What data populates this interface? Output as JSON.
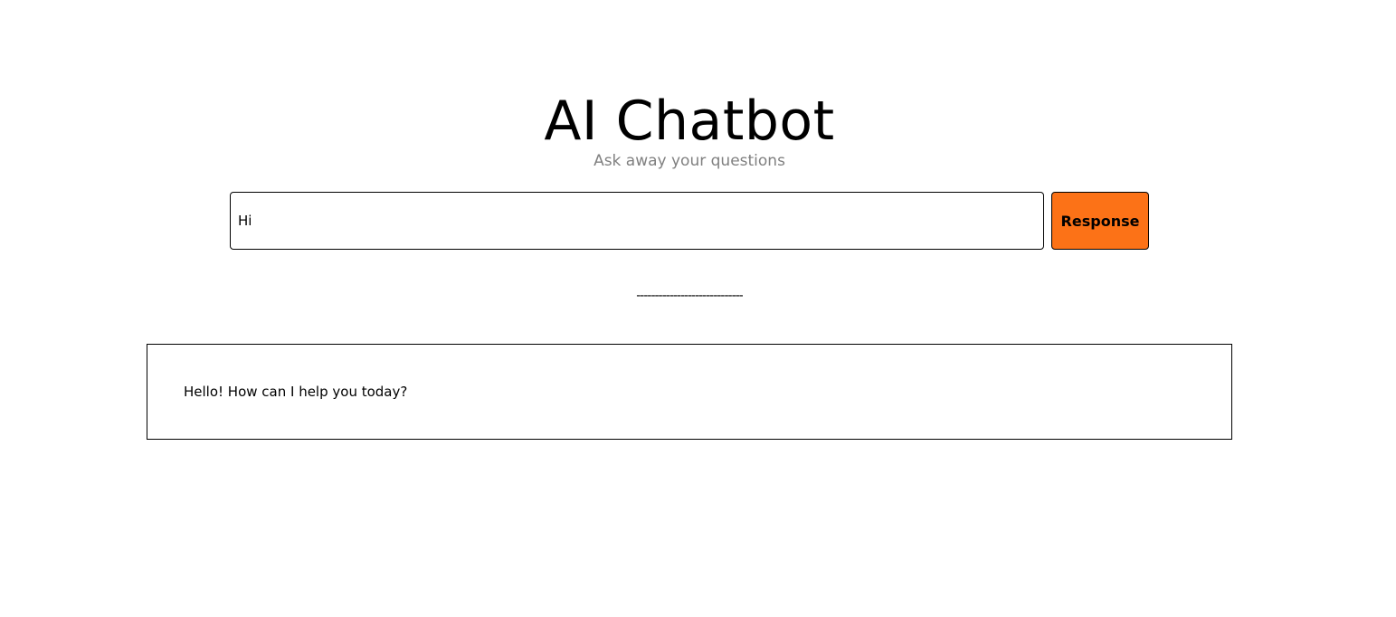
{
  "header": {
    "title": "AI Chatbot",
    "subtitle": "Ask away your questions"
  },
  "query": {
    "value": "Hi"
  },
  "response_button": {
    "label": "Response",
    "color": "#fc7217"
  },
  "divider": {
    "text": "-----------------------------"
  },
  "response": {
    "text": "Hello! How can I help you today?"
  }
}
